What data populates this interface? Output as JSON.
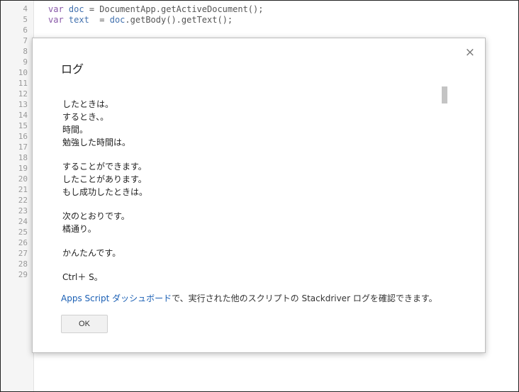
{
  "editor": {
    "line_numbers": [
      "4",
      "5",
      "6",
      "7",
      "8",
      "9",
      "10",
      "11",
      "12",
      "13",
      "14",
      "15",
      "16",
      "17",
      "18",
      "19",
      "20",
      "21",
      "22",
      "23",
      "24",
      "25",
      "26",
      "27",
      "28",
      "29"
    ],
    "line4": {
      "kw": "var",
      "name": "doc",
      "rest": " = DocumentApp.getActiveDocument();"
    },
    "line5": {
      "kw": "var",
      "name": "text",
      "mid": "  = ",
      "name2": "doc",
      "rest": ".getBody().getText();"
    }
  },
  "dialog": {
    "title": "ログ",
    "close_glyph": "×",
    "log_lines": [
      "したときは。",
      "するとき、。",
      "時間。",
      "勉強した時間は。",
      "",
      "することができます。",
      "したことがあります。",
      "もし成功したときは。",
      "",
      "次のとおりです。",
      "橘通り。",
      "",
      "かんたんです。",
      "",
      "Ctrl＋ S。"
    ],
    "footer_link": "Apps Script ダッシュボード",
    "footer_text": "で、実行された他のスクリプトの Stackdriver ログを確認できます。",
    "ok_label": "OK"
  }
}
